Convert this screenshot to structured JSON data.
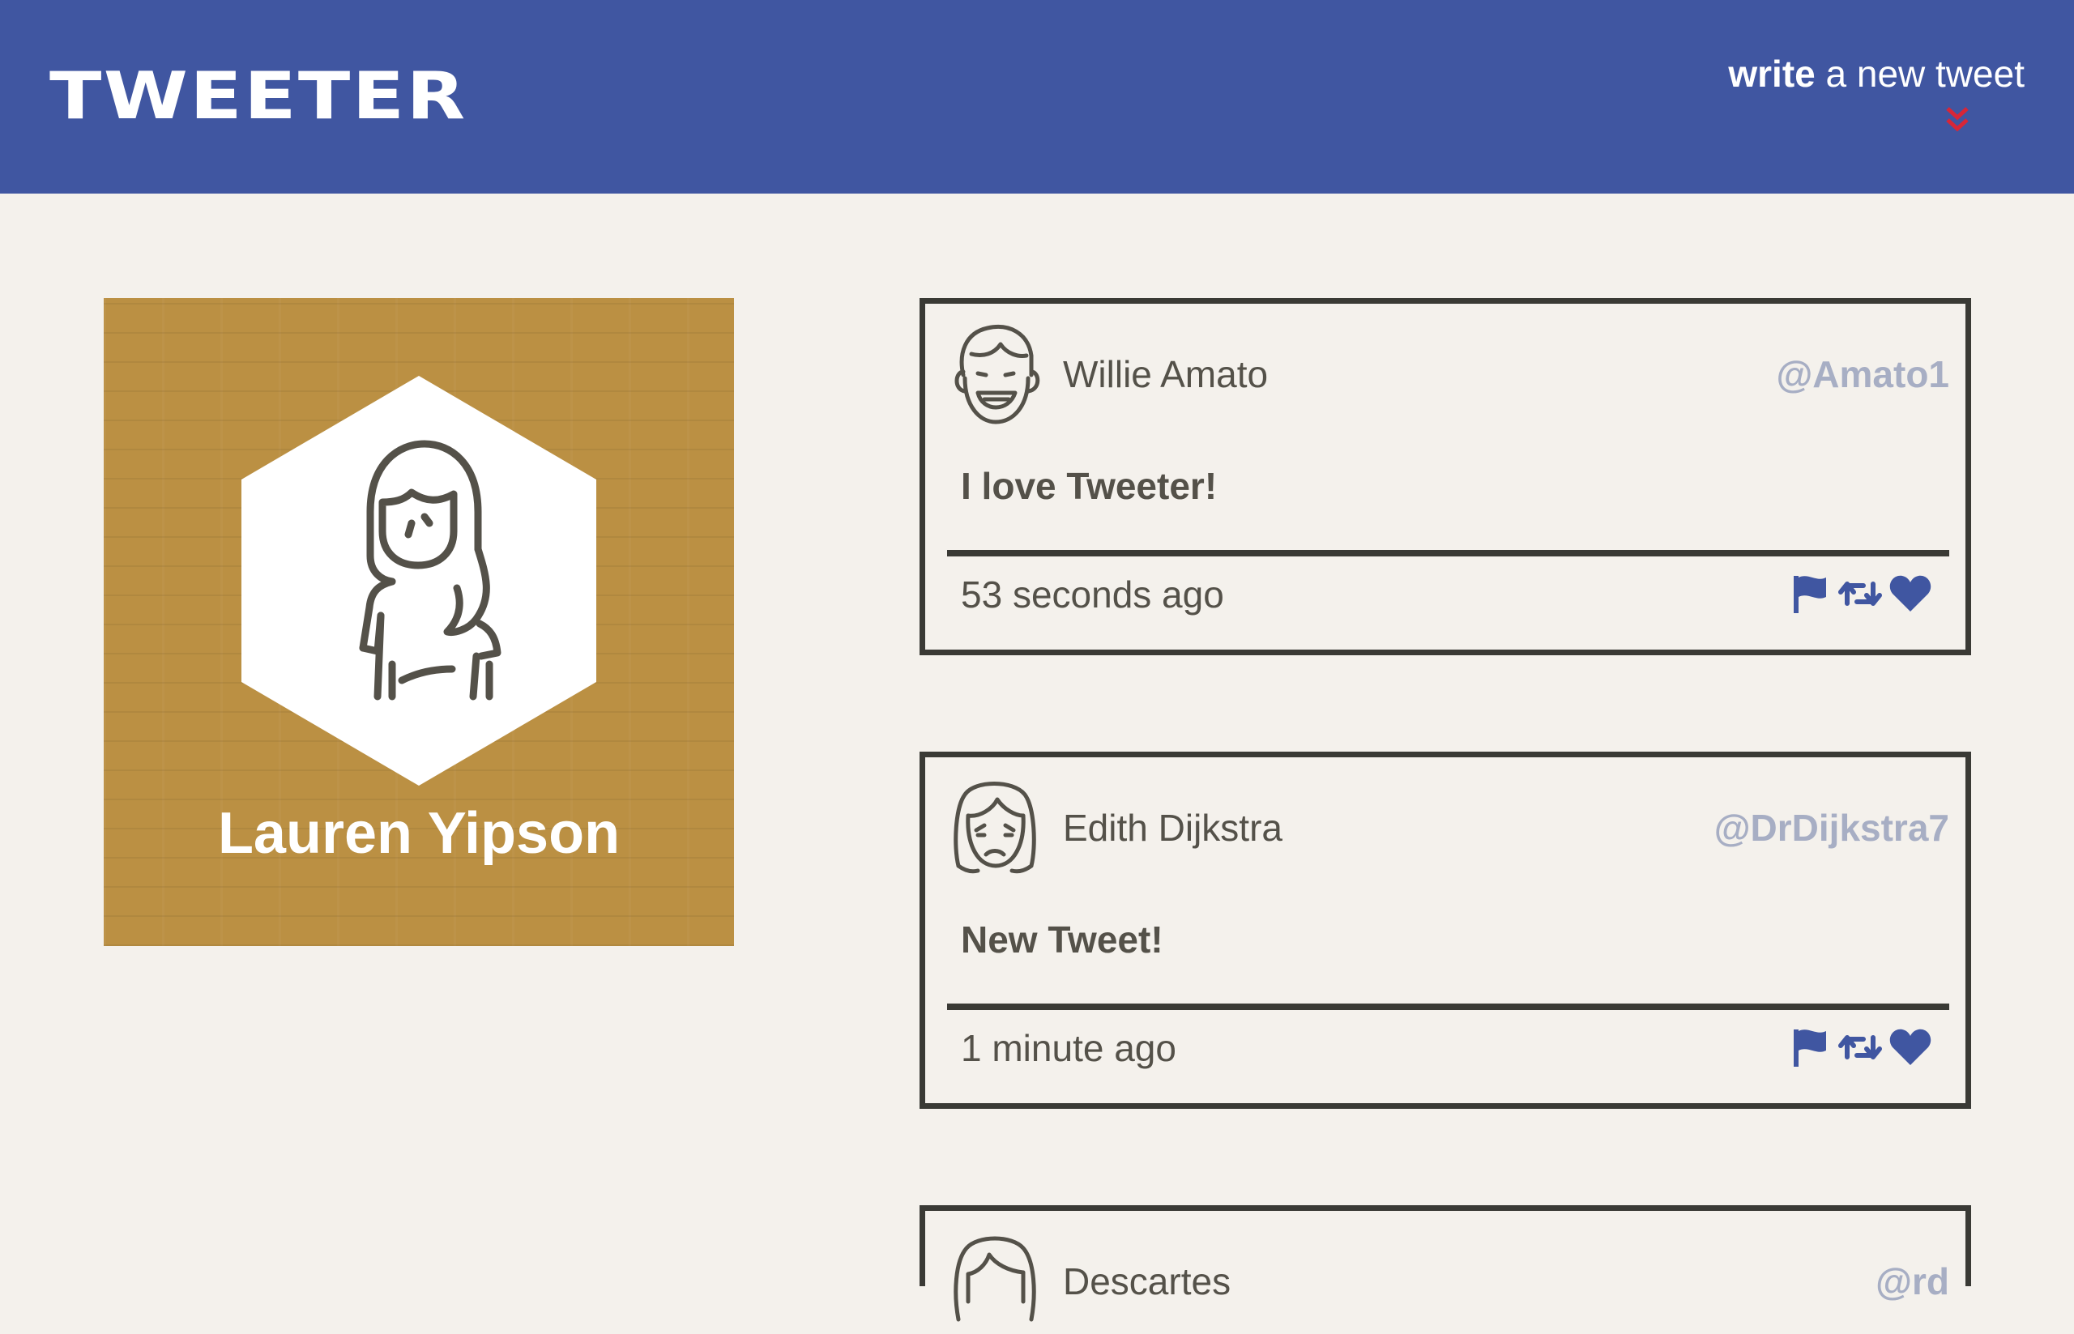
{
  "nav": {
    "brand": "TWEETER",
    "compose_strong": "write",
    "compose_rest": " a new tweet"
  },
  "colors": {
    "navbar": "#4056a1",
    "background": "#f4f1ec",
    "profile_card": "#bb9043",
    "compose_arrow": "#d72638",
    "action_icon": "#4056a1",
    "handle": "#a7aec4",
    "border": "#3a3a35"
  },
  "profile": {
    "name": "Lauren Yipson"
  },
  "tweets": [
    {
      "name": "Willie Amato",
      "handle": "@Amato1",
      "body": "I love Tweeter!",
      "time": "53 seconds ago",
      "avatar": "laughing-man-icon"
    },
    {
      "name": "Edith Dijkstra",
      "handle": "@DrDijkstra7",
      "body": "New Tweet!",
      "time": "1 minute ago",
      "avatar": "sad-woman-icon"
    },
    {
      "name": "Descartes",
      "handle": "@rd",
      "body": "",
      "time": "",
      "avatar": "woman-bangs-icon"
    }
  ],
  "icons": {
    "compose": "double-chevron-down-icon",
    "flag": "flag-icon",
    "retweet": "retweet-icon",
    "like": "heart-icon"
  }
}
